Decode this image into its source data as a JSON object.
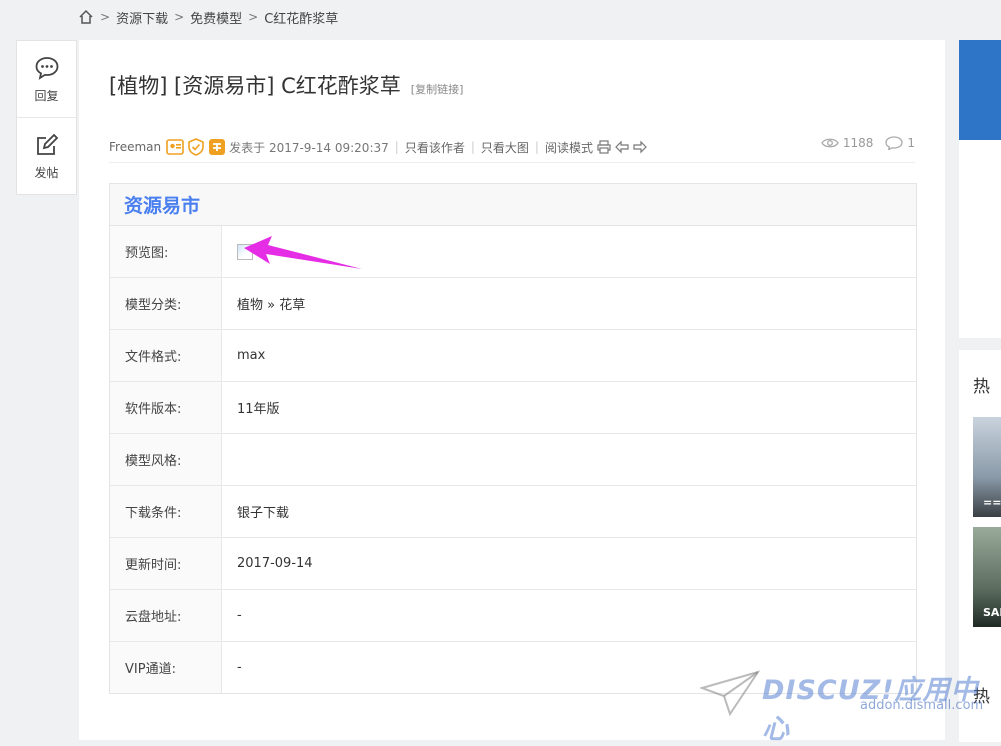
{
  "breadcrumb": {
    "items": [
      "资源下载",
      "免费模型",
      "C红花酢浆草"
    ],
    "separator": ">"
  },
  "side_actions": {
    "reply_label": "回复",
    "post_label": "发帖"
  },
  "thread": {
    "title": "[植物] [资源易市] C红花酢浆草",
    "copy_link": "[复制链接]",
    "author": "Freeman",
    "posted": "发表于 2017-9-14 09:20:37",
    "only_author": "只看该作者",
    "big_image": "只看大图",
    "read_mode": "阅读模式",
    "views": "1188",
    "replies": "1"
  },
  "info_table": {
    "header": "资源易市",
    "rows": [
      {
        "key": "预览图:",
        "value": ""
      },
      {
        "key": "模型分类:",
        "value": "植物 » 花草"
      },
      {
        "key": "文件格式:",
        "value": "max"
      },
      {
        "key": "软件版本:",
        "value": "11年版"
      },
      {
        "key": "模型风格:",
        "value": ""
      },
      {
        "key": "下载条件:",
        "value": "银子下载"
      },
      {
        "key": "更新时间:",
        "value": "2017-09-14"
      },
      {
        "key": "云盘地址:",
        "value": "-"
      },
      {
        "key": "VIP通道:",
        "value": "-"
      }
    ]
  },
  "right_col": {
    "heading1": "热",
    "thumb1_caption": "==",
    "thumb2_caption": "SAL",
    "heading2": "热"
  },
  "watermark": {
    "brand": "DISCUZ!应用中心",
    "url": "addon.dismall.com"
  },
  "colors": {
    "accent": "#4a7ff0",
    "arrow": "#e52de5",
    "medal": "#f0a020"
  }
}
